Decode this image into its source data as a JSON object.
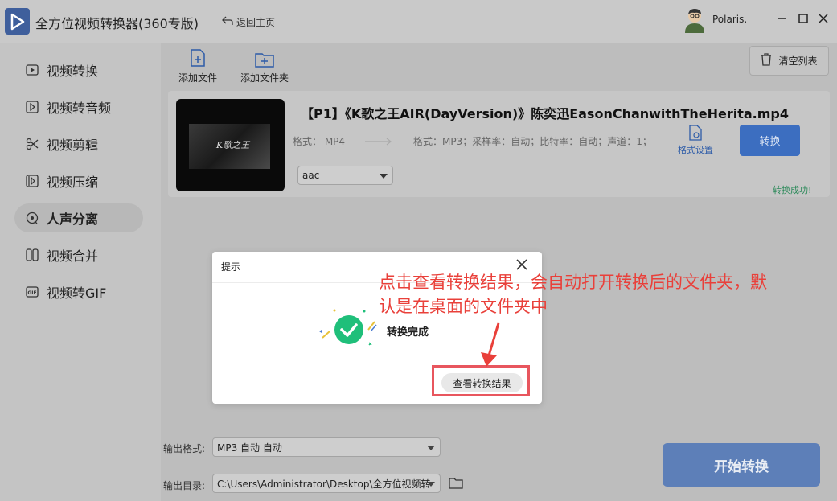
{
  "app": {
    "title": "全方位视频转换器(360专版)",
    "back_label": "返回主页",
    "user_name": "Polaris."
  },
  "sidebar": {
    "items": [
      {
        "label": "视频转换",
        "icon": "video-convert-icon",
        "active": false
      },
      {
        "label": "视频转音频",
        "icon": "video-to-audio-icon",
        "active": false
      },
      {
        "label": "视频剪辑",
        "icon": "scissors-icon",
        "active": false
      },
      {
        "label": "视频压缩",
        "icon": "compress-icon",
        "active": false
      },
      {
        "label": "人声分离",
        "icon": "vocal-separation-icon",
        "active": true
      },
      {
        "label": "视频合并",
        "icon": "merge-icon",
        "active": false
      },
      {
        "label": "视频转GIF",
        "icon": "gif-icon",
        "active": false
      }
    ]
  },
  "toolbar": {
    "add_file": "添加文件",
    "add_folder": "添加文件夹",
    "clear_list": "清空列表"
  },
  "file": {
    "name": "【P1】《K歌之王AIR(DayVersion)》陈奕迅EasonChanwithTheHerita.mp4",
    "thumb_text": "K歌之王",
    "source_format": "格式：  MP4",
    "target_format": "格式：MP3；采样率：自动；比特率：自动；声道：1；",
    "format_settings": "格式设置",
    "convert_label": "转换",
    "codec": "aac",
    "status": "转换成功!"
  },
  "bottom": {
    "output_format_label": "输出格式:",
    "output_format_value": "MP3 自动 自动",
    "output_dir_label": "输出目录:",
    "output_dir_value": "C:\\Users\\Administrator\\Desktop\\全方位视频转",
    "start_label": "开始转换"
  },
  "dialog": {
    "title": "提示",
    "message": "转换完成",
    "view_result": "查看转换结果"
  },
  "annotation": {
    "text": "点击查看转换结果，会自动打开转换后的文件夹，默认是在桌面的文件夹中",
    "color": "#e9403a"
  },
  "colors": {
    "accent": "#3c6ec0",
    "success": "#2c8a5a",
    "check_green": "#1fbf7a"
  }
}
